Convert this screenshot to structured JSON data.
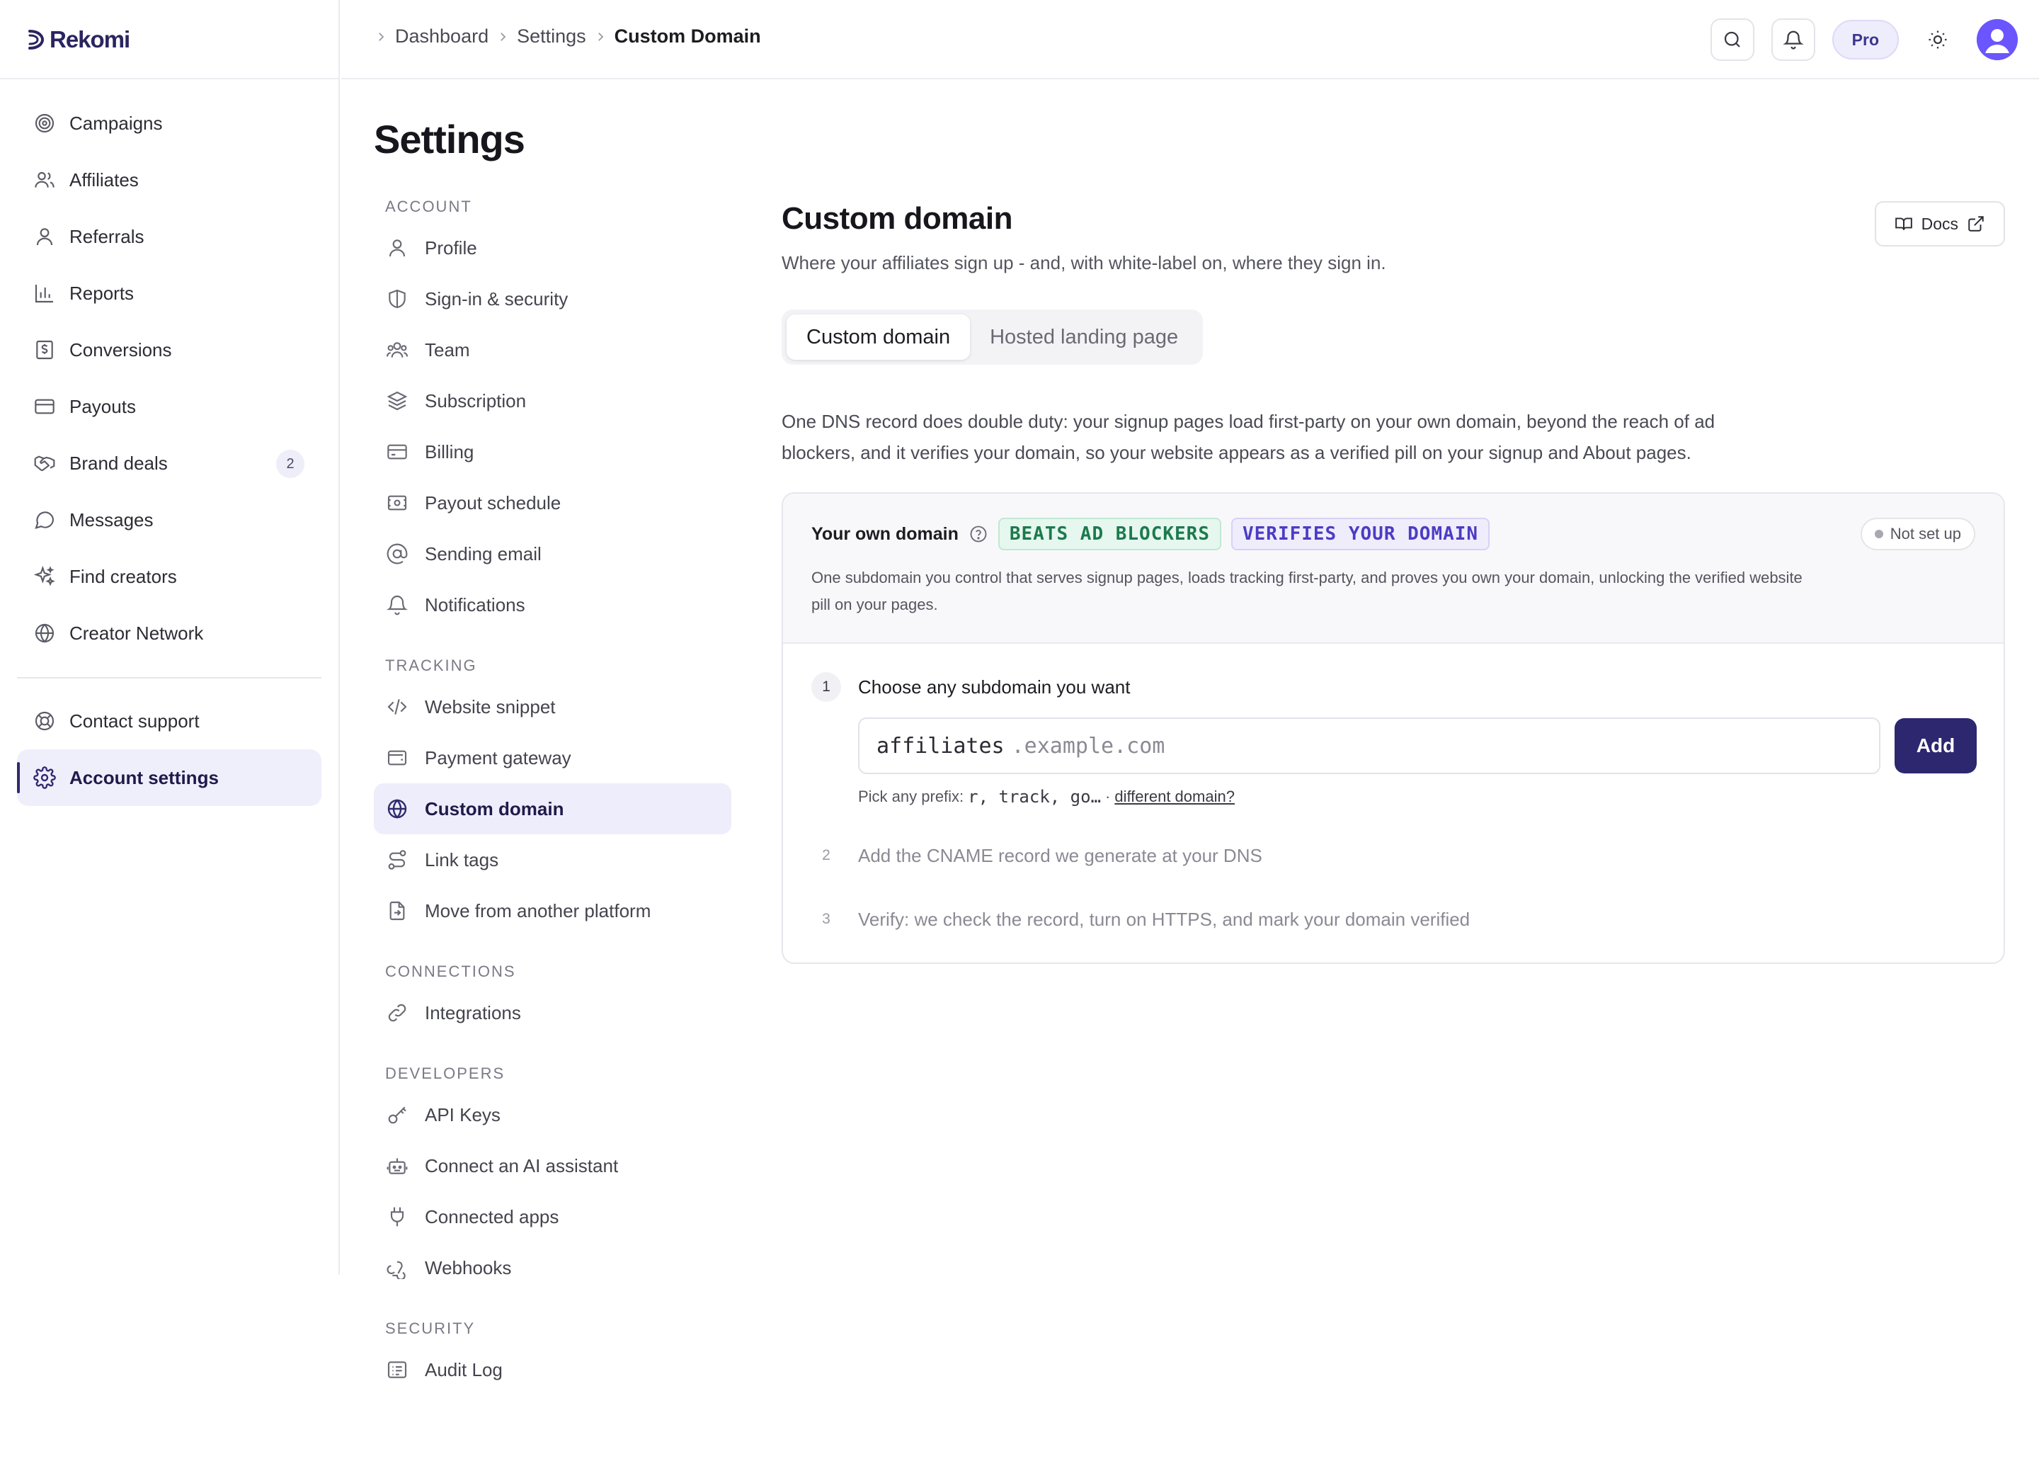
{
  "app": {
    "logo_text": "Rekomi"
  },
  "sidebar": {
    "items": [
      {
        "label": "Campaigns",
        "icon": "target-icon"
      },
      {
        "label": "Affiliates",
        "icon": "users-icon"
      },
      {
        "label": "Referrals",
        "icon": "user-icon"
      },
      {
        "label": "Reports",
        "icon": "bar-chart-icon"
      },
      {
        "label": "Conversions",
        "icon": "receipt-dollar-icon"
      },
      {
        "label": "Payouts",
        "icon": "credit-card-icon"
      },
      {
        "label": "Brand deals",
        "icon": "handshake-icon",
        "badge": "2"
      },
      {
        "label": "Messages",
        "icon": "message-circle-icon"
      },
      {
        "label": "Find creators",
        "icon": "sparkles-icon"
      },
      {
        "label": "Creator Network",
        "icon": "globe-icon"
      }
    ],
    "bottom_items": [
      {
        "label": "Contact support",
        "icon": "life-buoy-icon"
      },
      {
        "label": "Account settings",
        "icon": "gear-icon",
        "active": true
      }
    ]
  },
  "topbar": {
    "breadcrumb": [
      "Dashboard",
      "Settings",
      "Custom Domain"
    ],
    "plan_label": "Pro"
  },
  "settings": {
    "title": "Settings",
    "sections": [
      {
        "heading": "ACCOUNT",
        "items": [
          {
            "label": "Profile",
            "icon": "user-icon"
          },
          {
            "label": "Sign-in & security",
            "icon": "shield-icon"
          },
          {
            "label": "Team",
            "icon": "users-icon"
          },
          {
            "label": "Subscription",
            "icon": "layers-icon"
          },
          {
            "label": "Billing",
            "icon": "credit-card-icon"
          },
          {
            "label": "Payout schedule",
            "icon": "calendar-money-icon"
          },
          {
            "label": "Sending email",
            "icon": "at-sign-icon"
          },
          {
            "label": "Notifications",
            "icon": "bell-icon"
          }
        ]
      },
      {
        "heading": "TRACKING",
        "items": [
          {
            "label": "Website snippet",
            "icon": "code-icon"
          },
          {
            "label": "Payment gateway",
            "icon": "wallet-icon"
          },
          {
            "label": "Custom domain",
            "icon": "globe-icon",
            "active": true
          },
          {
            "label": "Link tags",
            "icon": "route-icon"
          },
          {
            "label": "Move from another platform",
            "icon": "file-import-icon"
          }
        ]
      },
      {
        "heading": "CONNECTIONS",
        "items": [
          {
            "label": "Integrations",
            "icon": "link-icon"
          }
        ]
      },
      {
        "heading": "DEVELOPERS",
        "items": [
          {
            "label": "API Keys",
            "icon": "key-icon"
          },
          {
            "label": "Connect an AI assistant",
            "icon": "bot-icon"
          },
          {
            "label": "Connected apps",
            "icon": "plug-icon"
          },
          {
            "label": "Webhooks",
            "icon": "webhook-icon"
          }
        ]
      },
      {
        "heading": "SECURITY",
        "items": [
          {
            "label": "Audit Log",
            "icon": "list-icon"
          }
        ]
      }
    ]
  },
  "content": {
    "title": "Custom domain",
    "subtitle": "Where your affiliates sign up - and, with white-label on, where they sign in.",
    "docs_label": "Docs",
    "tabs": [
      {
        "label": "Custom domain",
        "active": true
      },
      {
        "label": "Hosted landing page",
        "active": false
      }
    ],
    "description": "One DNS record does double duty: your signup pages load first-party on your own domain, beyond the reach of ad blockers, and it verifies your domain, so your website appears as a verified pill on your signup and About pages.",
    "card": {
      "title": "Your own domain",
      "tag_1": "BEATS AD BLOCKERS",
      "tag_2": "VERIFIES YOUR DOMAIN",
      "status": "Not set up",
      "description": "One subdomain you control that serves signup pages, loads tracking first-party, and proves you own your domain, unlocking the verified website pill on your pages.",
      "steps": [
        {
          "number": "1",
          "title": "Choose any subdomain you want"
        },
        {
          "number": "2",
          "title": "Add the CNAME record we generate at your DNS"
        },
        {
          "number": "3",
          "title": "Verify: we check the record, turn on HTTPS, and mark your domain verified"
        }
      ],
      "input_value": "affiliates",
      "input_suffix": ".example.com",
      "add_label": "Add",
      "hint_prefix": "Pick any prefix:",
      "hint_examples": "r, track, go…",
      "hint_separator": "·",
      "hint_link": "different domain?"
    }
  },
  "colors": {
    "accent": "#2d2770",
    "active_bg": "#eeedfb",
    "avatar": "#6a55ff"
  }
}
